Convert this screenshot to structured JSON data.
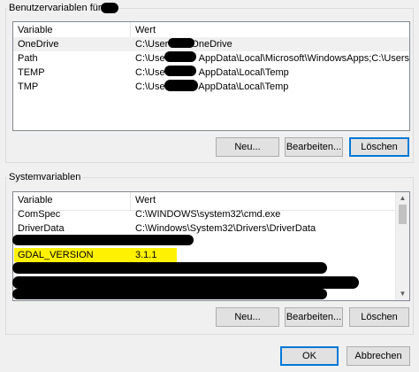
{
  "user_vars": {
    "group_title": "Benutzervariablen für",
    "columns": [
      "Variable",
      "Wert"
    ],
    "rows": [
      {
        "name": "OneDrive",
        "value_prefix": "C:\\User",
        "value_suffix": "OneDrive"
      },
      {
        "name": "Path",
        "value_prefix": "C:\\Use",
        "value_suffix": "AppData\\Local\\Microsoft\\WindowsApps;C:\\Users\\p..."
      },
      {
        "name": "TEMP",
        "value_prefix": "C:\\Use",
        "value_suffix": "AppData\\Local\\Temp"
      },
      {
        "name": "TMP",
        "value_prefix": "C:\\User",
        "value_suffix": "AppData\\Local\\Temp"
      }
    ],
    "buttons": {
      "new": "Neu...",
      "edit": "Bearbeiten...",
      "delete": "Löschen"
    }
  },
  "system_vars": {
    "group_title": "Systemvariablen",
    "columns": [
      "Variable",
      "Wert"
    ],
    "rows": [
      {
        "name": "ComSpec",
        "value": "C:\\WINDOWS\\system32\\cmd.exe"
      },
      {
        "name": "DriverData",
        "value": "C:\\Windows\\System32\\Drivers\\DriverData"
      },
      {
        "name": "GDAL_VERSION",
        "value": "3.1.1"
      }
    ],
    "buttons": {
      "new": "Neu...",
      "edit": "Bearbeiten...",
      "delete": "Löschen"
    },
    "highlight_color": "#fff200"
  },
  "dialog_buttons": {
    "ok": "OK",
    "cancel": "Abbrechen"
  },
  "colors": {
    "accent": "#0078d7",
    "redaction": "#000000"
  }
}
